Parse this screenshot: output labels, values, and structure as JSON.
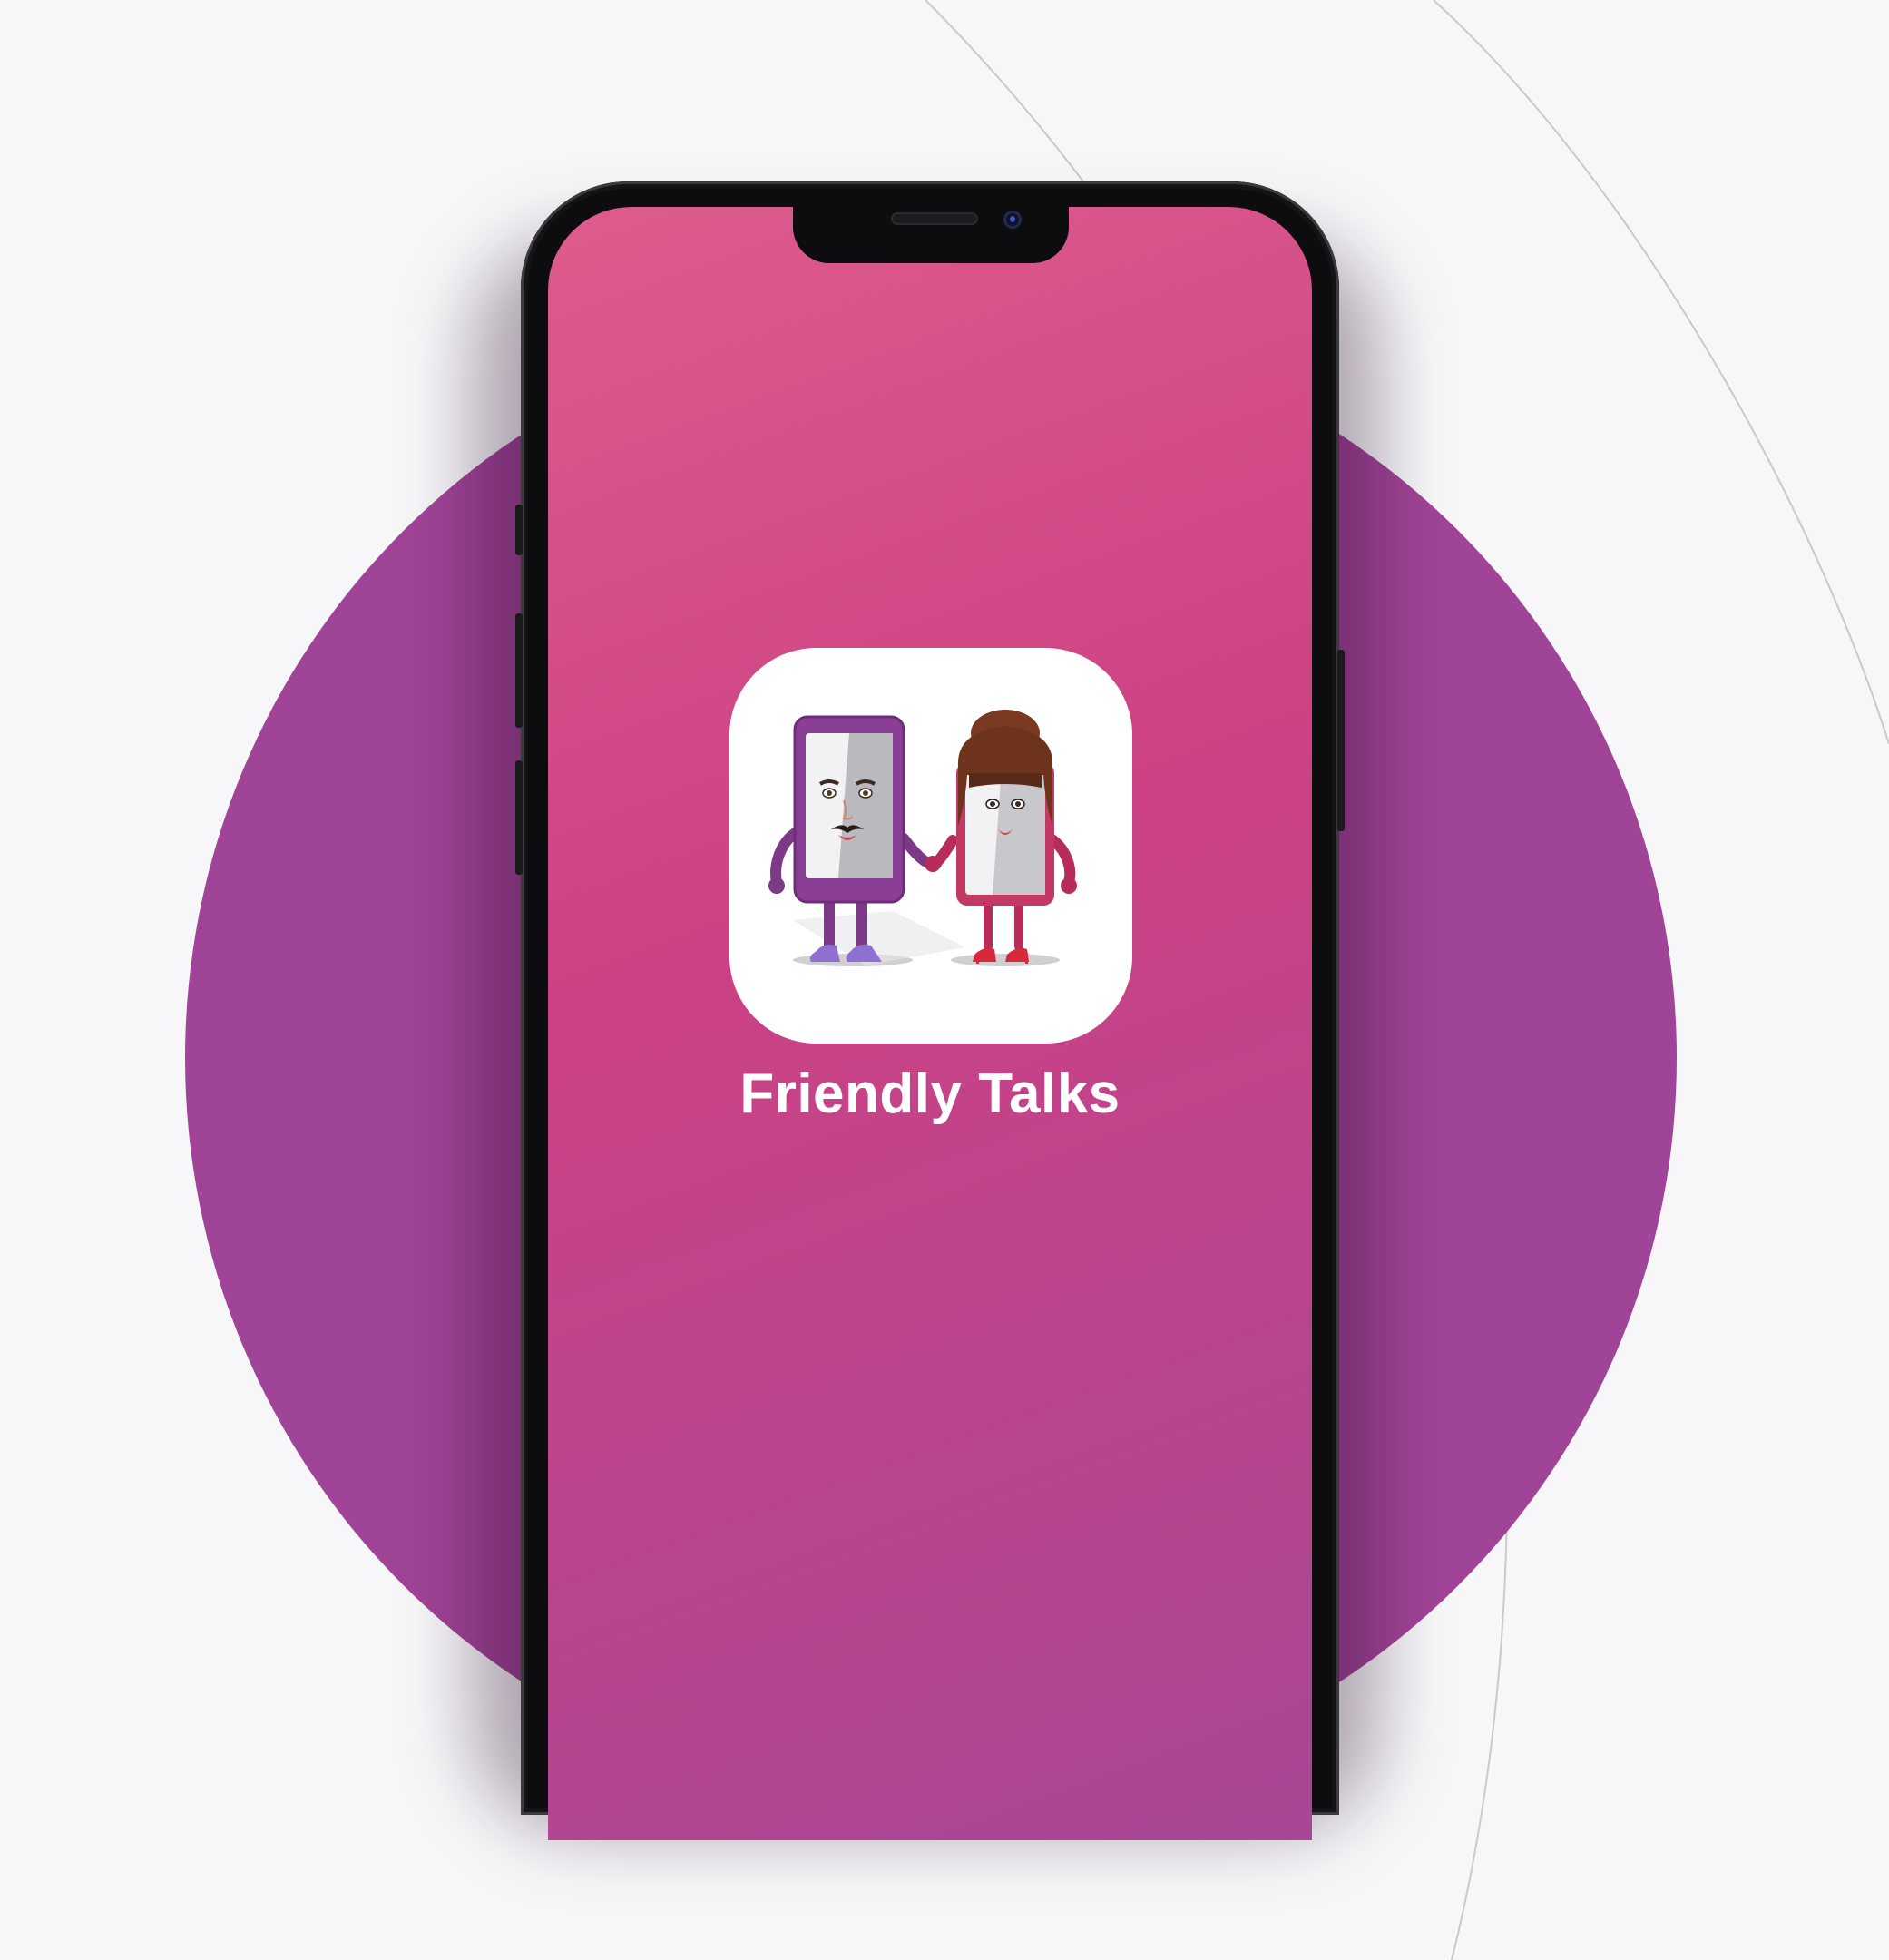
{
  "app": {
    "name": "Friendly Talks"
  },
  "colors": {
    "background": "#f7f7f9",
    "circle": "#a04497",
    "screen_gradient_start": "#dd5b8d",
    "screen_gradient_end": "#a84796",
    "phone_frame": "#0d0d0f",
    "title_text": "#ffffff"
  },
  "icons": {
    "app_icon": "two-phone-characters-holding-hands",
    "camera": "front-camera-icon",
    "speaker": "earpiece-speaker-icon"
  }
}
